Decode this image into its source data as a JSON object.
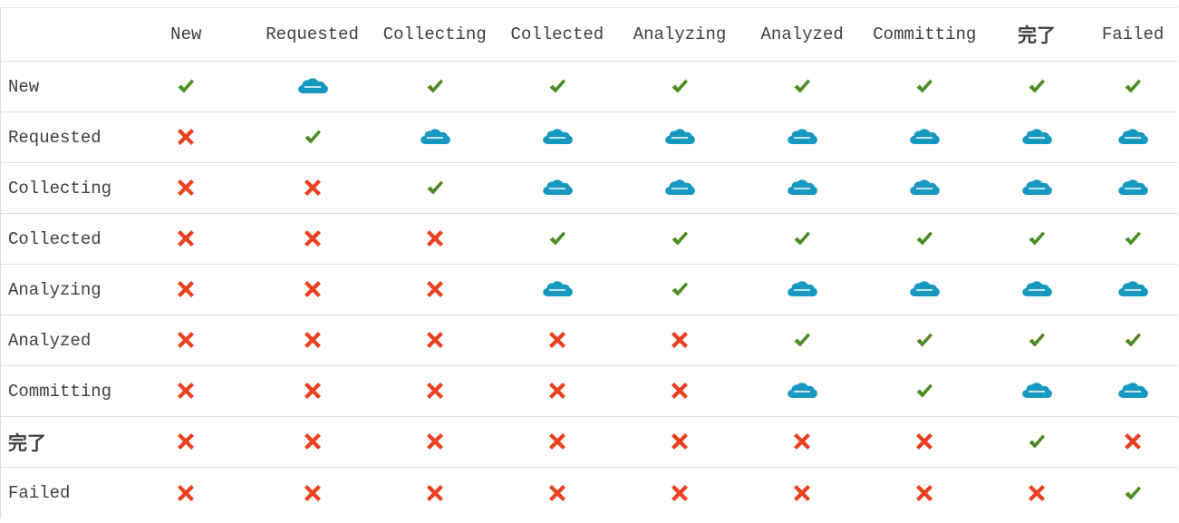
{
  "columns": [
    "New",
    "Requested",
    "Collecting",
    "Collected",
    "Analyzing",
    "Analyzed",
    "Committing",
    "完了",
    "Failed"
  ],
  "rows": [
    {
      "label": "New",
      "cells": [
        "yes",
        "sf",
        "yes",
        "yes",
        "yes",
        "yes",
        "yes",
        "yes",
        "yes"
      ]
    },
    {
      "label": "Requested",
      "cells": [
        "no",
        "yes",
        "sf",
        "sf",
        "sf",
        "sf",
        "sf",
        "sf",
        "sf"
      ]
    },
    {
      "label": "Collecting",
      "cells": [
        "no",
        "no",
        "yes",
        "sf",
        "sf",
        "sf",
        "sf",
        "sf",
        "sf"
      ]
    },
    {
      "label": "Collected",
      "cells": [
        "no",
        "no",
        "no",
        "yes",
        "yes",
        "yes",
        "yes",
        "yes",
        "yes"
      ]
    },
    {
      "label": "Analyzing",
      "cells": [
        "no",
        "no",
        "no",
        "sf",
        "yes",
        "sf",
        "sf",
        "sf",
        "sf"
      ]
    },
    {
      "label": "Analyzed",
      "cells": [
        "no",
        "no",
        "no",
        "no",
        "no",
        "yes",
        "yes",
        "yes",
        "yes"
      ]
    },
    {
      "label": "Committing",
      "cells": [
        "no",
        "no",
        "no",
        "no",
        "no",
        "sf",
        "yes",
        "sf",
        "sf"
      ]
    },
    {
      "label": "完了",
      "cells": [
        "no",
        "no",
        "no",
        "no",
        "no",
        "no",
        "no",
        "yes",
        "no"
      ]
    },
    {
      "label": "Failed",
      "cells": [
        "no",
        "no",
        "no",
        "no",
        "no",
        "no",
        "no",
        "no",
        "yes"
      ]
    }
  ],
  "legend_icons": {
    "yes": "checkmark-icon",
    "no": "cross-icon",
    "sf": "salesforce-cloud-icon"
  },
  "colors": {
    "check": "#4e8c23",
    "cross": "#e9401f",
    "cloud": "#1798c1",
    "border": "#d8dde6",
    "text": "#3e3e3c"
  }
}
